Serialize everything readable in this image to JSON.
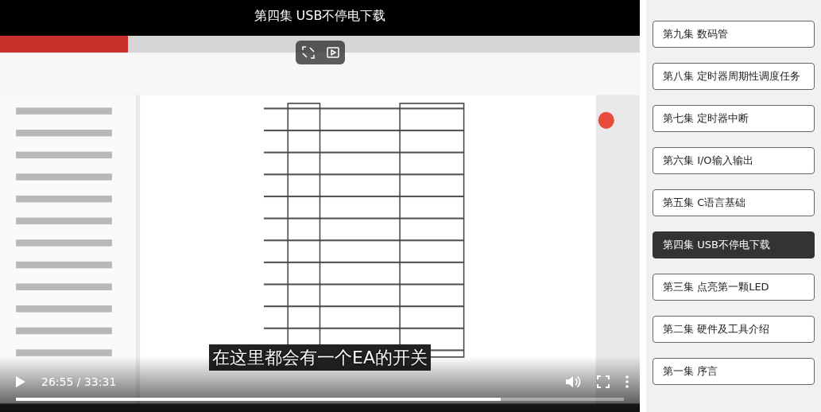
{
  "video": {
    "title": "第四集 USB不停电下载",
    "subtitle": "在这里都会有一个EA的开关",
    "playing": false,
    "time": "26:55 / 33:31",
    "progress": {
      "level": 0.797
    }
  },
  "playlist": [
    {
      "label": "第九集 数码管",
      "selected": false
    },
    {
      "label": "第八集 定时器周期性调度任务",
      "selected": false
    },
    {
      "label": "第七集 定时器中断",
      "selected": false
    },
    {
      "label": "第六集 I/O输入输出",
      "selected": false
    },
    {
      "label": "第五集 C语言基础",
      "selected": false
    },
    {
      "label": "第四集 USB不停电下载",
      "selected": true
    },
    {
      "label": "第三集 点亮第一颗LED",
      "selected": false
    },
    {
      "label": "第二集 硬件及工具介绍",
      "selected": false
    },
    {
      "label": "第一集 序言",
      "selected": false
    }
  ]
}
